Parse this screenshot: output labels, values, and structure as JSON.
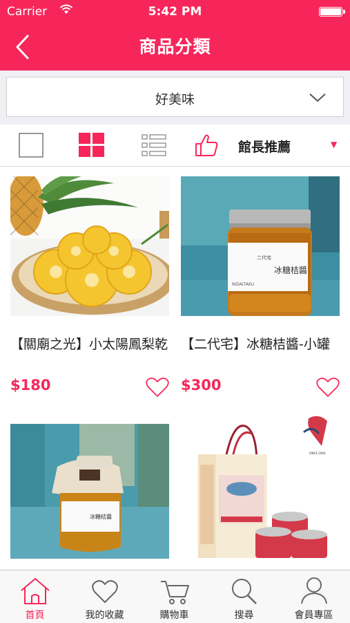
{
  "status_bar": {
    "carrier": "Carrier",
    "time": "5:42 PM"
  },
  "header": {
    "title": "商品分類",
    "back_icon": "chevron-left-icon"
  },
  "category_select": {
    "selected": "好美味"
  },
  "view_bar": {
    "modes": [
      "single-view-icon",
      "grid-view-icon",
      "list-view-icon"
    ],
    "active_mode": "grid-view-icon",
    "sort_label": "館長推薦"
  },
  "products": [
    {
      "name": "【關廟之光】小太陽鳳梨乾",
      "price": "$180"
    },
    {
      "name": "【二代宅】冰糖桔醬-小罐",
      "price": "$300"
    },
    {
      "name": "",
      "price": ""
    },
    {
      "name": "",
      "price": ""
    }
  ],
  "product_images": {
    "jar_label": "冰糖桔醬",
    "jar_sub": "二代宅",
    "jar_brand": "NIDAITAKU",
    "jar2_label": "冰糖桔醬",
    "seal_text": "SINCE 2004"
  },
  "tabbar": {
    "items": [
      {
        "label": "首頁",
        "icon": "home-icon",
        "active": true
      },
      {
        "label": "我的收藏",
        "icon": "heart-icon",
        "active": false
      },
      {
        "label": "購物車",
        "icon": "cart-icon",
        "active": false
      },
      {
        "label": "搜尋",
        "icon": "search-icon",
        "active": false
      },
      {
        "label": "會員專區",
        "icon": "user-icon",
        "active": false
      }
    ]
  },
  "colors": {
    "accent": "#f7265a",
    "background": "#efeff4"
  }
}
